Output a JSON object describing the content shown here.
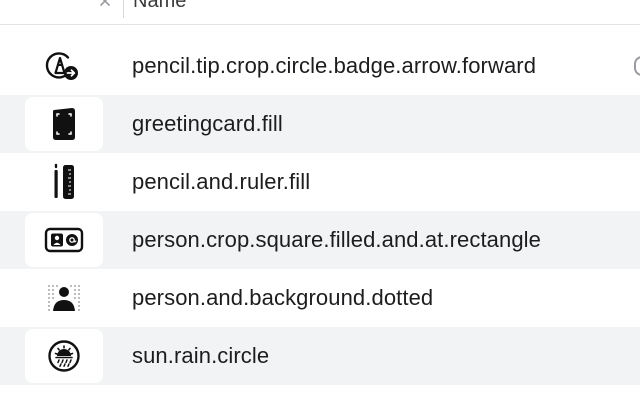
{
  "header": {
    "column_label": "Name",
    "close_icon": "close-icon"
  },
  "rows": [
    {
      "label": "pencil.tip.crop.circle.badge.arrow.forward",
      "icon": "pencil-tip-crop-circle-badge-arrow-forward-icon"
    },
    {
      "label": "greetingcard.fill",
      "icon": "greetingcard-fill-icon"
    },
    {
      "label": "pencil.and.ruler.fill",
      "icon": "pencil-and-ruler-fill-icon"
    },
    {
      "label": "person.crop.square.filled.and.at.rectangle",
      "icon": "person-crop-square-filled-and-at-rectangle-icon"
    },
    {
      "label": "person.and.background.dotted",
      "icon": "person-and-background-dotted-icon"
    },
    {
      "label": "sun.rain.circle",
      "icon": "sun-rain-circle-icon"
    }
  ],
  "colors": {
    "alt_row": "#f2f3f5",
    "text": "#1d1d1f",
    "separator": "#e3e3e5"
  }
}
